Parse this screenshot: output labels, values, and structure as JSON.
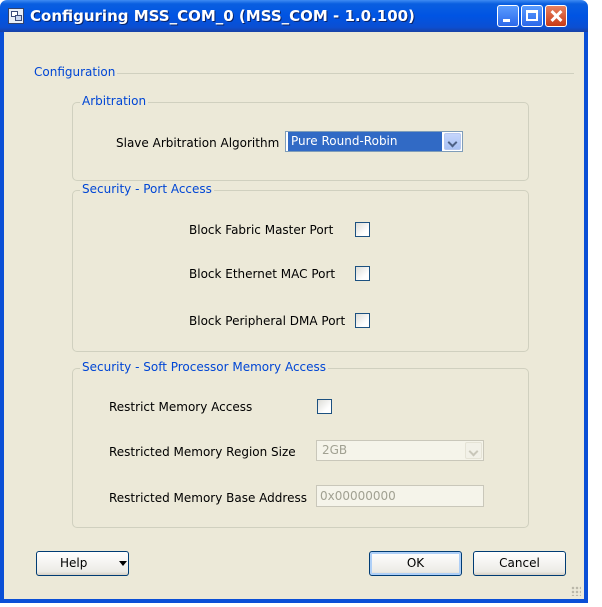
{
  "window": {
    "title": "Configuring MSS_COM_0 (MSS_COM - 1.0.100)",
    "icon": "app-window-icon"
  },
  "configuration": {
    "title": "Configuration"
  },
  "arbitration": {
    "title": "Arbitration",
    "algorithm_label": "Slave Arbitration Algorithm",
    "algorithm_value": "Pure Round-Robin"
  },
  "port_access": {
    "title": "Security - Port Access",
    "items": [
      {
        "label": "Block Fabric Master Port",
        "checked": false
      },
      {
        "label": "Block Ethernet MAC Port",
        "checked": false
      },
      {
        "label": "Block Peripheral DMA Port",
        "checked": false
      }
    ]
  },
  "soft_processor": {
    "title": "Security - Soft Processor Memory Access",
    "restrict_label": "Restrict Memory Access",
    "restrict_checked": false,
    "region_size_label": "Restricted Memory Region Size",
    "region_size_value": "2GB",
    "base_address_label": "Restricted Memory Base Address",
    "base_address_value": "0x00000000"
  },
  "buttons": {
    "help": "Help",
    "ok": "OK",
    "cancel": "Cancel"
  },
  "colors": {
    "titlebar": "#0054e3",
    "group_title": "#0046d5",
    "dialog_bg": "#ece9d8",
    "selection": "#316ac5"
  }
}
